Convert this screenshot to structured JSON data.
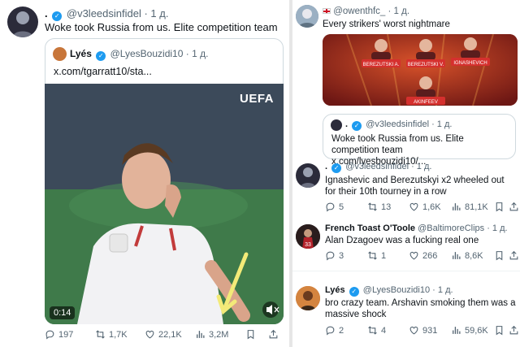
{
  "left": {
    "tweet": {
      "display": ".",
      "handle": "@v3leedsinfidel",
      "time": "· 1 д.",
      "text": "Woke took Russia from us. Elite competition team"
    },
    "quote": {
      "name": "Lyés",
      "handle": "@LyesBouzidi10",
      "time": "· 1 д.",
      "link": "x.com/tgarratt10/sta..."
    },
    "video": {
      "brand": "UEFA",
      "duration": "0:14"
    },
    "metrics": {
      "replies": "197",
      "retweets": "1,7K",
      "likes": "22,1K",
      "views": "3,2M"
    }
  },
  "right": {
    "post": {
      "handle": "@owenthfc_",
      "time": "· 1 д.",
      "text": "Every strikers' worst nightmare",
      "players": [
        "BEREZUTSKI A.",
        "BEREZUTSKI V.",
        "IGNASHEVICH",
        "AKINFEEV"
      ]
    },
    "quote": {
      "display": ".",
      "handle": "@v3leedsinfidel",
      "time": "· 1 д.",
      "text": "Woke took Russia from us. Elite competition team x.com/lyesbouzidi10/..."
    },
    "replies": [
      {
        "display": ".",
        "handle": "@v3leedsinfidel",
        "time": "· 1 д.",
        "text": "Ignashevic and Berezutskyi x2 wheeled out for their 10th tourney in a row",
        "metrics": {
          "replies": "5",
          "retweets": "13",
          "likes": "1,6K",
          "views": "81,1K"
        }
      },
      {
        "display": "French Toast O'Toole",
        "handle": "@BaltimoreClips",
        "time": "· 1 д.",
        "text": "Alan Dzagoev was a fucking real one",
        "metrics": {
          "replies": "3",
          "retweets": "1",
          "likes": "266",
          "views": "8,6K"
        }
      },
      {
        "display": "Lyés",
        "handle": "@LyesBouzidi10",
        "time": "· 1 д.",
        "text": "bro crazy team. Arshavin smoking them was a massive shock",
        "metrics": {
          "replies": "2",
          "retweets": "4",
          "likes": "931",
          "views": "59,6K"
        }
      }
    ]
  }
}
